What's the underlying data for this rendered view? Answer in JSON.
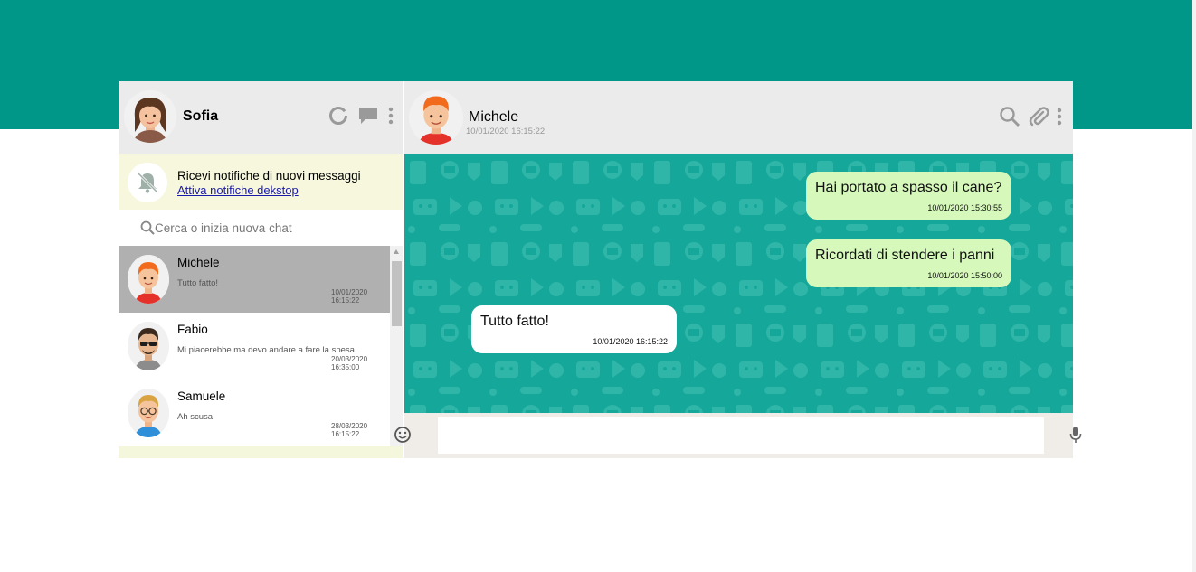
{
  "colors": {
    "brand": "#009688",
    "chat_background": "#14a79a",
    "sent_bubble": "#d6f9bb",
    "received_bubble": "#ffffff",
    "active_contact": "#b0b0b0",
    "notification_bar": "#f6f7dc"
  },
  "me": {
    "name": "Sofia",
    "avatar": "girl-avatar"
  },
  "left_header_icons": [
    "status-circle-icon",
    "chat-bubble-icon",
    "kebab-menu-icon"
  ],
  "notifications": {
    "icon": "bell-off-icon",
    "title": "Ricevi notifiche di nuovi messaggi",
    "link": "Attiva notifiche dekstop"
  },
  "search": {
    "placeholder": "Cerca o inizia nuova chat",
    "icon": "search-icon"
  },
  "contacts": [
    {
      "name": "Michele",
      "last_message": "Tutto fatto!",
      "date": "10/01/2020",
      "time": "16:15:22",
      "avatar": "red-hair-boy-avatar",
      "active": true
    },
    {
      "name": "Fabio",
      "last_message": "Mi piacerebbe ma devo andare a fare la spesa.",
      "date": "20/03/2020",
      "time": "16:35:00",
      "avatar": "sunglasses-man-avatar",
      "active": false
    },
    {
      "name": "Samuele",
      "last_message": "Ah scusa!",
      "date": "28/03/2020",
      "time": "16:15:22",
      "avatar": "glasses-man-avatar",
      "active": false
    }
  ],
  "chat": {
    "name": "Michele",
    "last_seen": "10/01/2020 16:15:22",
    "header_icons": [
      "search-icon",
      "paperclip-icon",
      "kebab-menu-icon"
    ],
    "messages": [
      {
        "text": "Hai portato a spasso il cane?",
        "time": "10/01/2020 15:30:55",
        "direction": "sent"
      },
      {
        "text": "Ricordati di stendere i panni",
        "time": "10/01/2020 15:50:00",
        "direction": "sent"
      },
      {
        "text": "Tutto fatto!",
        "time": "10/01/2020 16:15:22",
        "direction": "received"
      }
    ]
  },
  "composer": {
    "placeholder": "",
    "left_icon": "emoji-icon",
    "right_icon": "microphone-icon"
  }
}
